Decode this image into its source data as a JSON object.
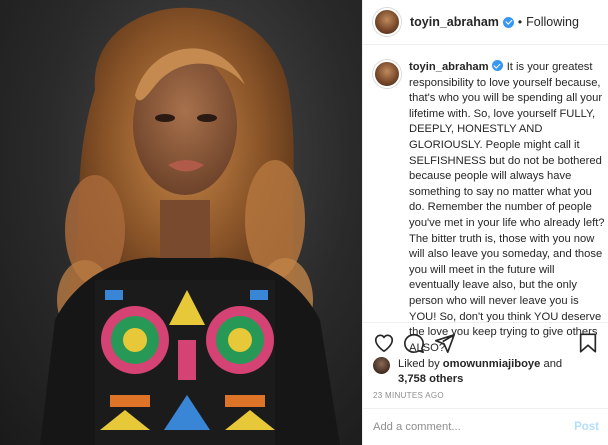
{
  "post": {
    "username": "toyin_abraham",
    "follow_dot": "•",
    "follow_status": "Following"
  },
  "caption": {
    "username": "toyin_abraham",
    "text": " It is your greatest responsibility to love yourself because, that's who you will be spending all your lifetime with. So, love yourself FULLY, DEEPLY, HONESTLY AND GLORIOUSLY. People might call it SELFISHNESS but do not be bothered because people will always have something to say no matter what you do. Remember the number of people you've met in your life who already left? The bitter truth is, those with you now will also leave you someday, and those you will meet in the future will eventually leave also, but the only person who will never leave you is YOU! So, don't you think YOU deserve the love you keep trying to give others ALSO?"
  },
  "likes": {
    "prefix": "Liked by ",
    "liker": "omowunmiajiboye",
    "connector": " and",
    "others": "3,758 others"
  },
  "timestamp": "23 MINUTES AGO",
  "comment": {
    "placeholder": "Add a comment...",
    "post_label": "Post"
  },
  "icons": {
    "like": "heart-icon",
    "comment": "comment-icon",
    "share": "share-icon",
    "save": "bookmark-icon",
    "verified": "verified-badge-icon"
  },
  "colors": {
    "verified": "#3897f0",
    "post_button_disabled": "#b2dffc",
    "muted_text": "#8e8e8e"
  }
}
